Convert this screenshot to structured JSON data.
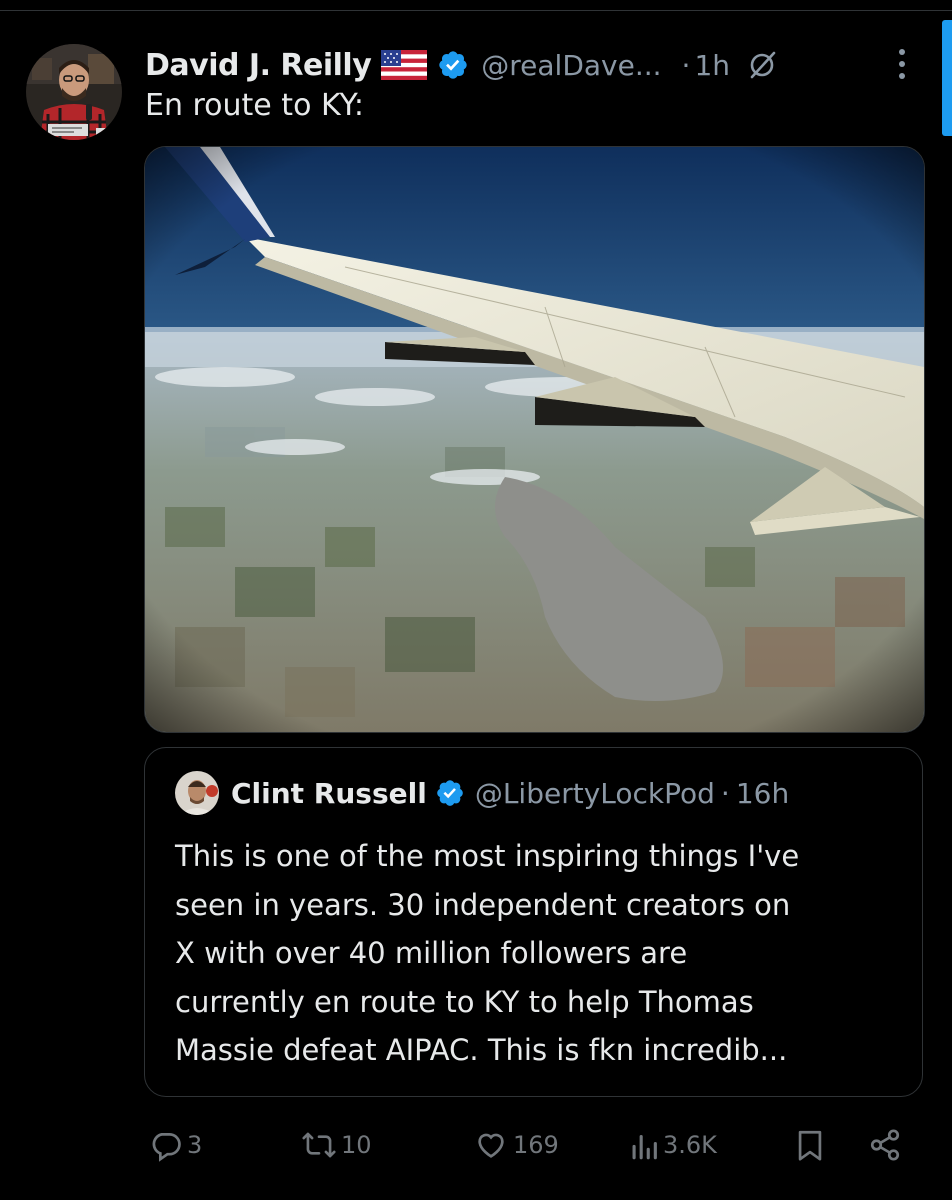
{
  "author": {
    "name": "David J. Reilly",
    "flag_icon": "us-flag-icon",
    "verified_icon": "verified-badge-icon",
    "handle": "@realDave...",
    "separator": "·",
    "time": "1h"
  },
  "tweet": {
    "text": "En route to KY:",
    "media_description_icon": "airplane-wing-photo"
  },
  "quote": {
    "author_name": "Clint Russell",
    "handle": "@LibertyLockPod",
    "separator": "·",
    "time": "16h",
    "text_lines": [
      "This is one of the most inspiring things I've",
      "seen in years. 30 independent creators on",
      "X with over 40 million followers are",
      "currently en route to KY to help Thomas",
      "Massie defeat AIPAC. This is fkn incredib..."
    ]
  },
  "actions": {
    "replies": "3",
    "reposts": "10",
    "likes": "169",
    "views": "3.6K"
  },
  "colors": {
    "background": "#000000",
    "text": "#e7e9ea",
    "secondary": "#8b98a5",
    "action": "#71767b",
    "accent": "#1d9bf0",
    "border": "#2f3336"
  }
}
